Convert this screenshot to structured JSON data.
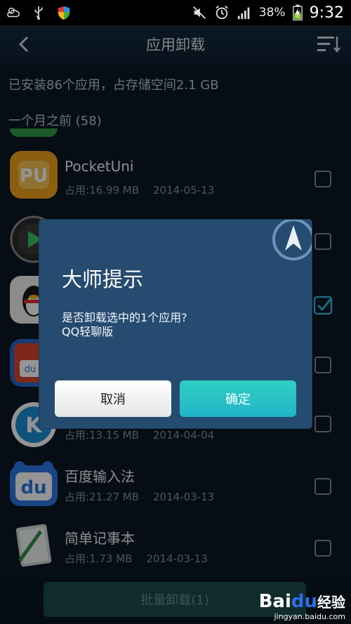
{
  "status_bar": {
    "battery_percent": "38%",
    "time": "9:32",
    "icons": [
      "cloud-weather-icon",
      "usb-icon",
      "shield-icon",
      "mute-icon",
      "alarm-icon",
      "signal-icon",
      "battery-icon"
    ]
  },
  "header": {
    "title": "应用卸载",
    "icons": [
      "back-arrow-icon",
      "sort-icon"
    ]
  },
  "summary": "已安装86个应用，占存储空间2.1 GB",
  "section_header": "一个月之前 (58)",
  "apps": [
    {
      "name": "PocketUni",
      "size": "占用:16.99 MB",
      "date": "2014-05-13",
      "checked": false,
      "icon": "pocketuni-icon",
      "icon_color": "#f0a21c"
    },
    {
      "name": "",
      "size": "",
      "date": "",
      "checked": false,
      "icon": "media-player-icon",
      "icon_color": "#2c2c2c"
    },
    {
      "name": "",
      "size": "",
      "date": "",
      "checked": true,
      "icon": "qq-penguin-icon",
      "icon_color": "#f2f2f2"
    },
    {
      "name": "",
      "size": "",
      "date": "",
      "checked": false,
      "icon": "baidu-app-icon",
      "icon_color": "#d8462a"
    },
    {
      "name": "",
      "size": "占用:13.15 MB",
      "date": "2014-04-04",
      "checked": false,
      "icon": "k-app-icon",
      "icon_color": "#1b8fd6"
    },
    {
      "name": "百度输入法",
      "size": "占用:21.27 MB",
      "date": "2014-03-13",
      "checked": false,
      "icon": "baidu-input-icon",
      "icon_color": "#2b78e4"
    },
    {
      "name": "简单记事本",
      "size": "占用:1.73 MB",
      "date": "2014-03-13",
      "checked": false,
      "icon": "notepad-icon",
      "icon_color": "#cfd8d4"
    }
  ],
  "batch_button": "批量卸载(1)",
  "dialog": {
    "title": "大师提示",
    "message_line1": "是否卸载选中的1个应用?",
    "message_line2": "QQ轻聊版",
    "cancel": "取消",
    "confirm": "确定"
  },
  "watermark": {
    "logo_part1": "Bai",
    "logo_part2": "du",
    "logo_part3": "经验",
    "url": "jingyan.baidu.com"
  }
}
